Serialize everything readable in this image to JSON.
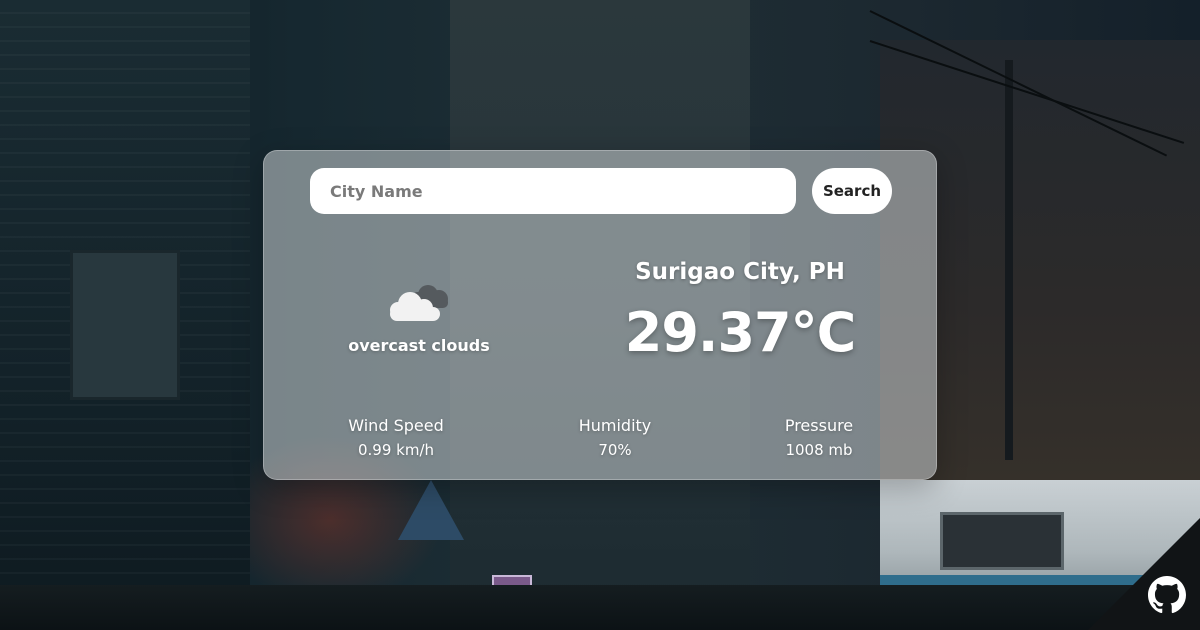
{
  "search": {
    "placeholder": "City Name",
    "value": "",
    "button_label": "Search"
  },
  "weather": {
    "icon": "overcast-cloud-icon",
    "description": "overcast clouds",
    "location": "Surigao City, PH",
    "temperature": "29.37°C"
  },
  "stats": {
    "wind": {
      "label": "Wind Speed",
      "value": "0.99 km/h"
    },
    "humidity": {
      "label": "Humidity",
      "value": "70%"
    },
    "pressure": {
      "label": "Pressure",
      "value": "1008 mb"
    }
  },
  "corner": {
    "icon": "github-icon"
  },
  "colors": {
    "card_background": "#cdd4d6",
    "input_background": "#ffffff",
    "text": "#ffffff"
  }
}
